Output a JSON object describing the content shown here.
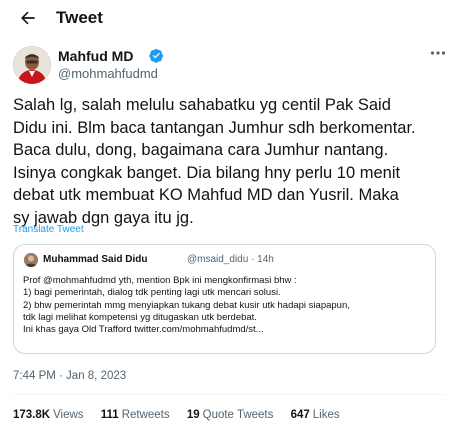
{
  "header": {
    "title": "Tweet"
  },
  "tweet": {
    "author_name": "Mahfud MD",
    "author_handle": "@mohmahfudmd",
    "text": "Salah lg, salah melulu sahabatku yg centil Pak Said\nDidu ini. Blm baca tantangan Jumhur sdh berkomentar.\nBaca dulu, dong, bagaimana cara Jumhur nantang.\nIsinya congkak banget. Dia bilang hny perlu 10 menit\ndebat utk membuat KO Mahfud MD dan Yusril. Maka\nsy jawab dgn gaya itu jg.",
    "translate_label": "Translate Tweet",
    "timestamp": "7:44 PM · Jan 8, 2023"
  },
  "quote": {
    "author_name": "Muhammad Said Didu",
    "meta": "@msaid_didu · 14h",
    "text": "Prof @mohmahfudmd yth, mention Bpk ini mengkonfirmasi bhw :\n1) bagi pemerintah, dialog tdk penting lagi utk mencari solusi.\n2) bhw pemerintah mmg menyiapkan tukang debat kusir utk hadapi siapapun,\ntdk lagi melihat kompetensi yg ditugaskan utk berdebat.\nIni khas gaya Old Trafford twitter.com/mohmahfudmd/st..."
  },
  "stats": {
    "views_count": "173.8K",
    "views_label": "Views",
    "retweets_count": "111",
    "retweets_label": "Retweets",
    "quotes_count": "19",
    "quotes_label": "Quote Tweets",
    "likes_count": "647",
    "likes_label": "Likes"
  },
  "colors": {
    "link": "#1d9bf0",
    "muted": "#536471",
    "border": "#cfd9de"
  },
  "icons": {
    "back": "arrow-left-icon",
    "verified": "verified-badge-icon",
    "more": "more-dots-icon"
  }
}
